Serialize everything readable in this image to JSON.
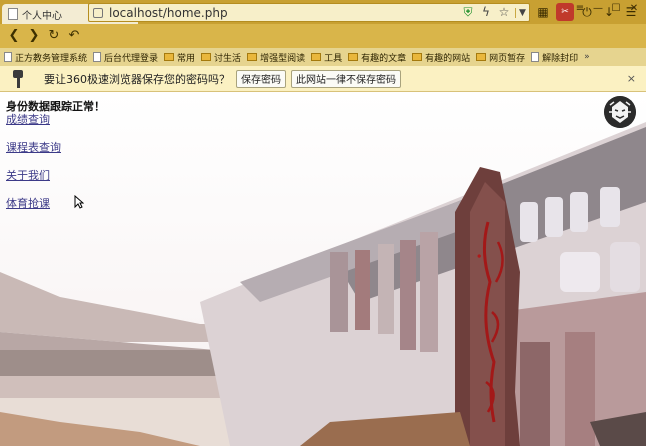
{
  "browser": {
    "tab_title": "个人中心",
    "tab_close": "×",
    "new_tab": "+",
    "url": "localhost/home.php"
  },
  "bookmarks": [
    {
      "label": "正方教务管理系统",
      "type": "page"
    },
    {
      "label": "后台代理登录",
      "type": "page"
    },
    {
      "label": "常用",
      "type": "folder"
    },
    {
      "label": "讨生活",
      "type": "folder"
    },
    {
      "label": "增强型阅读",
      "type": "folder"
    },
    {
      "label": "工具",
      "type": "folder"
    },
    {
      "label": "有趣的文章",
      "type": "folder"
    },
    {
      "label": "有趣的网站",
      "type": "folder"
    },
    {
      "label": "网页暂存",
      "type": "folder"
    },
    {
      "label": "解除封印",
      "type": "page"
    }
  ],
  "bookmarks_more": "»",
  "password_bar": {
    "message": "要让360极速浏览器保存您的密码吗？",
    "save_label": "保存密码",
    "never_label": "此网站一律不保存密码",
    "close": "×"
  },
  "page": {
    "status": "身份数据跟踪正常！",
    "links": [
      "成绩查询",
      "课程表查询",
      "关于我们",
      "体育抢课"
    ]
  }
}
